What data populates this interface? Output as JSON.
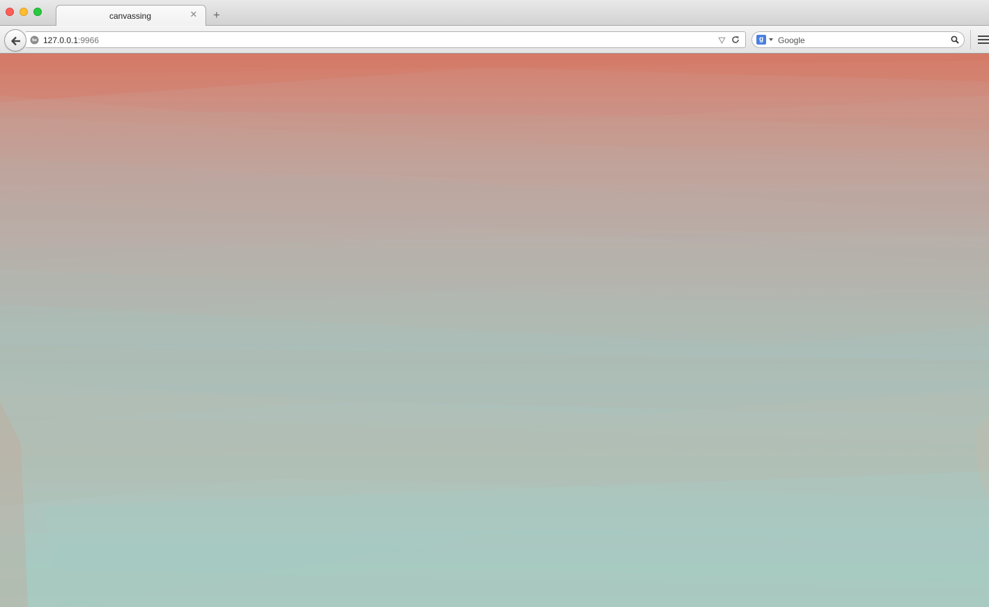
{
  "window": {
    "controls": [
      "close",
      "minimize",
      "zoom"
    ]
  },
  "tabs": [
    {
      "title": "canvassing",
      "active": true
    }
  ],
  "toolbar": {
    "url_host": "127.0.0.1",
    "url_port": ":9966",
    "search_placeholder": "Google",
    "search_engine_letter": "g"
  },
  "icons": {
    "back": "back-arrow-icon",
    "site_identity": "globe-icon",
    "bookmark": "star-icon",
    "reload": "reload-icon",
    "search": "search-icon",
    "menu": "hamburger-menu-icon",
    "new_tab": "plus-icon",
    "close_tab": "close-icon"
  },
  "colors": {
    "canvas_top": "#d47d6a",
    "canvas_middle": "#b0b9b2",
    "canvas_bottom": "#a7cbc2",
    "close_light": "#fc5f57",
    "minimize_light": "#fdbd2f",
    "zoom_light": "#28c940",
    "search_engine": "#4a7fe0"
  }
}
